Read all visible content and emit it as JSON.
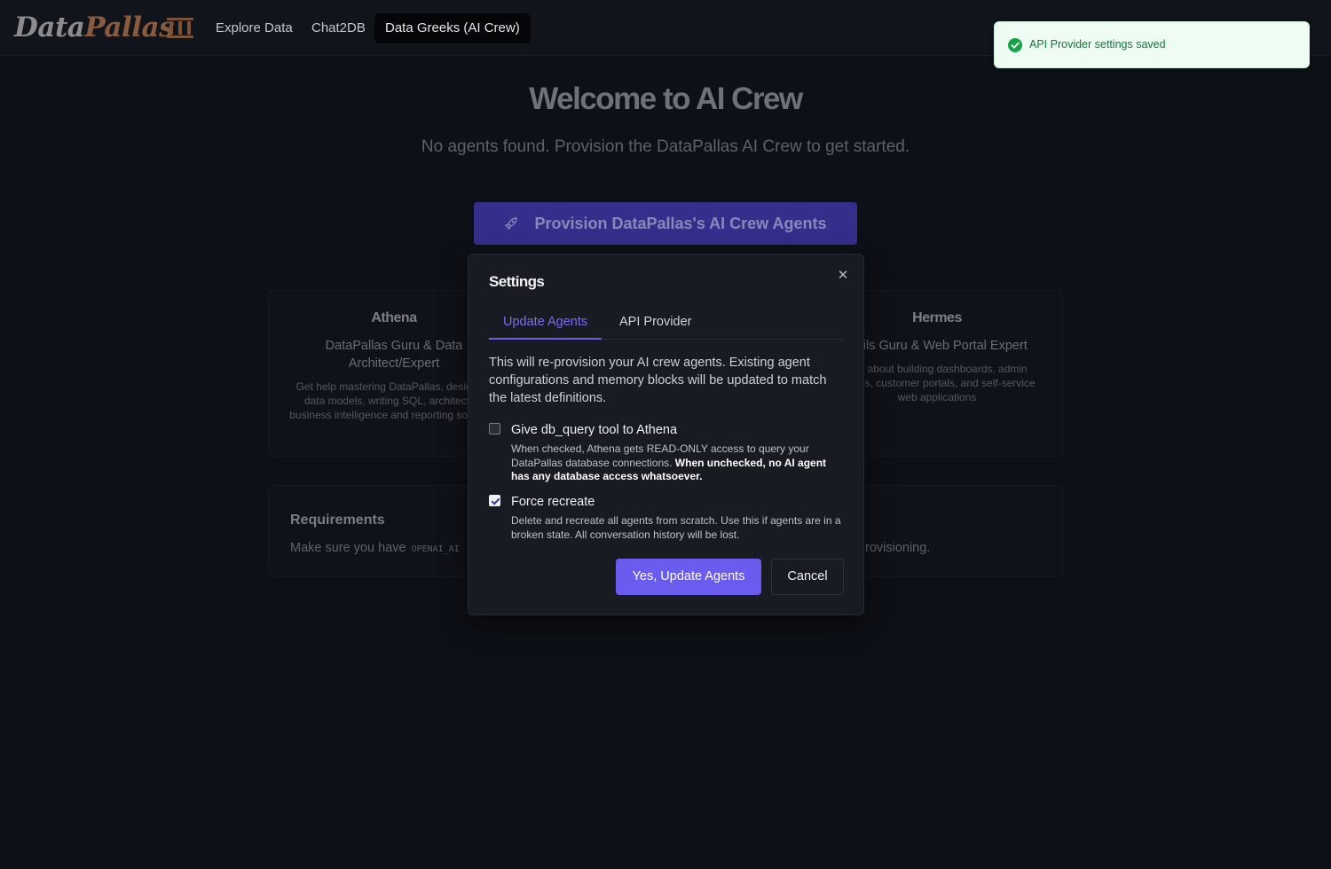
{
  "header": {
    "logo": {
      "part1": "Data",
      "part2": "Pallas"
    },
    "nav": [
      {
        "label": "Explore Data",
        "active": false
      },
      {
        "label": "Chat2DB",
        "active": false
      },
      {
        "label": "Data Greeks (AI Crew)",
        "active": true
      }
    ]
  },
  "page": {
    "title": "Welcome to AI Crew",
    "subtitle": "No agents found. Provision the DataPallas AI Crew to get started.",
    "provision_label": "Provision DataPallas's AI Crew Agents",
    "provision_icon": "rocket-icon",
    "cards": [
      {
        "name": "Athena",
        "role": "DataPallas Guru & Data Architect/Expert",
        "description": "Get help mastering DataPallas, designing data models, writing SQL, architecting business intelligence and reporting solutions"
      },
      {
        "name": "Hermes",
        "role": "Rails Guru & Web Portal Expert",
        "description": "Ask about building dashboards, admin panels, customer portals, and self-service web applications"
      }
    ],
    "requirements": {
      "title": "Requirements",
      "text_start": "Make sure you have",
      "code": "OPENAI_AI",
      "text_end": "rovisioning."
    }
  },
  "modal": {
    "title": "Settings",
    "close_icon": "close-icon",
    "tabs": [
      {
        "label": "Update Agents",
        "active": true
      },
      {
        "label": "API Provider",
        "active": false
      }
    ],
    "intro": "This will re-provision your AI crew agents. Existing agent configurations and memory blocks will be updated to match the latest definitions.",
    "options": [
      {
        "label": "Give db_query tool to Athena",
        "checked": false,
        "description": "When checked, Athena gets READ-ONLY access to query your DataPallas database connections.",
        "description_bold": "When unchecked, no AI agent has any database access whatsoever."
      },
      {
        "label": "Force recreate",
        "checked": true,
        "description": "Delete and recreate all agents from scratch. Use this if agents are in a broken state. All conversation history will be lost."
      }
    ],
    "confirm_label": "Yes, Update Agents",
    "cancel_label": "Cancel"
  },
  "toast": {
    "message": "API Provider settings saved",
    "icon": "check-circle-icon",
    "color": "#16a34a"
  },
  "colors": {
    "accent": "#6b5cf0",
    "background": "#0d1016",
    "modal_bg": "#181b22"
  }
}
